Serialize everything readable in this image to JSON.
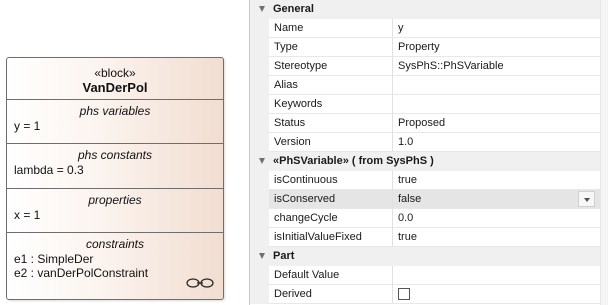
{
  "diagram": {
    "block": {
      "stereotype": "«block»",
      "name": "VanDerPol",
      "compartments": [
        {
          "title": "phs variables",
          "items": [
            "y = 1"
          ]
        },
        {
          "title": "phs constants",
          "items": [
            "lambda = 0.3"
          ]
        },
        {
          "title": "properties",
          "items": [
            "x = 1"
          ]
        },
        {
          "title": "constraints",
          "items": [
            "e1 : SimpleDer",
            "e2 : vanDerPolConstraint"
          ]
        }
      ],
      "link_icon": "chain-link-icon"
    }
  },
  "properties": {
    "sections": [
      {
        "title": "General",
        "rows": [
          {
            "name": "Name",
            "value": "y"
          },
          {
            "name": "Type",
            "value": "Property"
          },
          {
            "name": "Stereotype",
            "value": "SysPhS::PhSVariable"
          },
          {
            "name": "Alias",
            "value": ""
          },
          {
            "name": "Keywords",
            "value": ""
          },
          {
            "name": "Status",
            "value": "Proposed"
          },
          {
            "name": "Version",
            "value": "1.0"
          }
        ]
      },
      {
        "title": "«PhSVariable»  ( from SysPhS )",
        "rows": [
          {
            "name": "isContinuous",
            "value": "true"
          },
          {
            "name": "isConserved",
            "value": "false"
          },
          {
            "name": "changeCycle",
            "value": "0.0"
          },
          {
            "name": "isInitialValueFixed",
            "value": "true"
          }
        ]
      },
      {
        "title": "Part",
        "rows": [
          {
            "name": "Default Value",
            "value": ""
          },
          {
            "name": "Derived",
            "value": ""
          }
        ]
      }
    ],
    "icons": {
      "collapse": "collapse-triangle-icon",
      "dropdown": "dropdown-arrow-icon",
      "checkbox": "checkbox-icon"
    }
  }
}
